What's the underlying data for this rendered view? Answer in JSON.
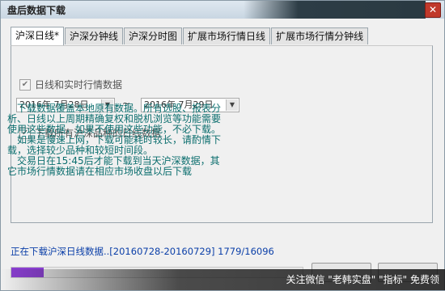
{
  "window": {
    "title": "盘后数据下载",
    "close_glyph": "✕"
  },
  "tabs": [
    {
      "label": "沪深日线*",
      "active": true
    },
    {
      "label": "沪深分钟线"
    },
    {
      "label": "沪深分时图"
    },
    {
      "label": "扩展市场行情日线"
    },
    {
      "label": "扩展市场行情分钟线"
    }
  ],
  "panel": {
    "option1_label": "日线和实时行情数据",
    "start_date": "2016年 7月28日",
    "end_date": "2016年 7月29日",
    "date_separator": "~",
    "option2_label": "下载所有沪深品种的日线数据",
    "info_lines": [
      "　下载数据覆盖本地原有数据。所有选股、报表分",
      "析、日线以上周期精确复权和脱机浏览等功能需要",
      "使用这些数据，如果不使用这些功能，不必下载。",
      "　如果是慢速上网，下载可能耗时较长，请酌情下",
      "载，选择较少品种和较短时间段。",
      "　交易日在15:45后才能下载到当天沪深数据，其",
      "它市场行情数据请在相应市场收盘以后下载"
    ]
  },
  "status": {
    "text": "正在下载沪深日线数据..[20160728-20160729] 1779/16096",
    "progress_fraction": 0.1105
  },
  "footer": {
    "text": "关注微信 \"老韩实盘\" \"指标\" 免费领"
  },
  "colors": {
    "accent": "#8a3fd1",
    "status_text": "#0b3fa8",
    "info_text": "#0b6e6e"
  }
}
